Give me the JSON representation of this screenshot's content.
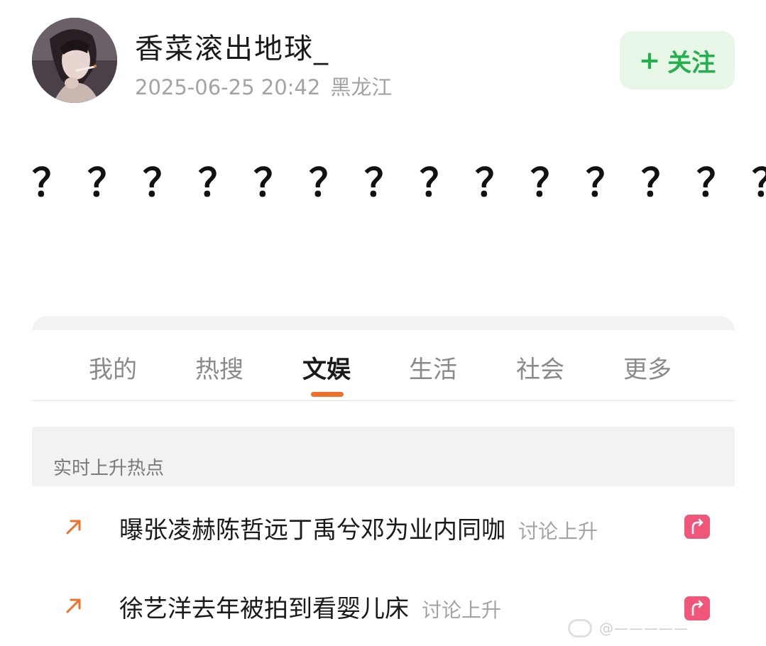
{
  "post": {
    "username": "香菜滚出地球_",
    "timestamp": "2025-06-25 20:42",
    "location": "黑龙江",
    "follow_label": "关注",
    "follow_plus": "+",
    "body_text": "？？？？？？？？？？？？？？？？？？？？？"
  },
  "card": {
    "tabs": [
      {
        "label": "我的"
      },
      {
        "label": "热搜"
      },
      {
        "label": "文娱"
      },
      {
        "label": "生活"
      },
      {
        "label": "社会"
      },
      {
        "label": "更多"
      }
    ],
    "active_tab": "文娱",
    "section_title": "实时上升热点",
    "hot_items": [
      {
        "title": "曝张凌赫陈哲远丁禹兮邓为业内同咖",
        "status": "讨论上升"
      },
      {
        "title": "徐艺洋去年被拍到看婴儿床",
        "status": "讨论上升"
      }
    ]
  },
  "colors": {
    "accent_orange": "#f0702a",
    "follow_green": "#22b14c",
    "follow_bg": "#e8f6e8",
    "badge_pink": "#f2557a"
  },
  "icons": {
    "avatar": "avatar-photo",
    "trend": "arrow-up-right-icon",
    "badge": "rising-badge-icon"
  },
  "watermark": {
    "text": "@—————"
  }
}
